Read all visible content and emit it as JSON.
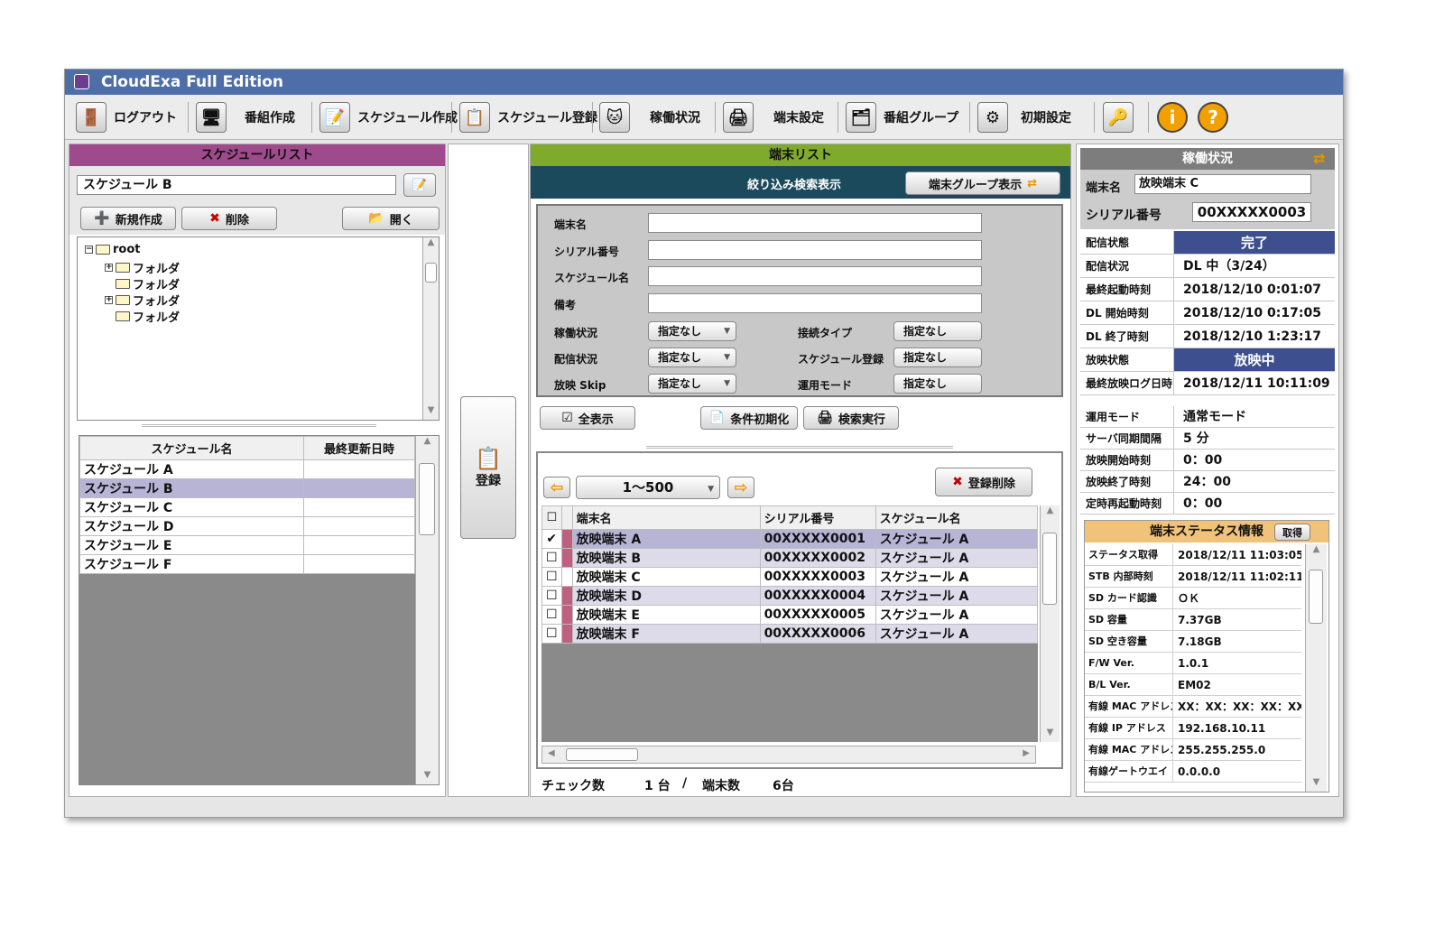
{
  "app": {
    "title": "CloudExa Full Edition"
  },
  "toolbar": {
    "logout": "ログアウト",
    "program": "番組作成",
    "schedule_create": "スケジュール作成",
    "schedule_register": "スケジュール登録",
    "operation_status": "稼働状況",
    "terminal_settings": "端末設定",
    "program_group": "番組グループ",
    "initial_settings": "初期設定"
  },
  "schedule_list": {
    "header": "スケジュールリスト",
    "current": "スケジュール B",
    "new_btn": "新規作成",
    "delete_btn": "削除",
    "open_btn": "開く",
    "tree": {
      "root": "root",
      "folders": [
        "フォルダ",
        "フォルダ",
        "フォルダ",
        "フォルダ"
      ]
    },
    "columns": [
      "スケジュール名",
      "最終更新日時"
    ],
    "rows": [
      "スケジュール A",
      "スケジュール B",
      "スケジュール C",
      "スケジュール D",
      "スケジュール E",
      "スケジュール F"
    ]
  },
  "register": {
    "label": "登録"
  },
  "terminal_list": {
    "header": "端末リスト",
    "filter_title": "絞り込み検索表示",
    "group_btn": "端末グループ表示",
    "filters": {
      "terminal_name": "端末名",
      "serial": "シリアル番号",
      "schedule": "スケジュール名",
      "note": "備考",
      "op_status": "稼働状況",
      "delivery_status": "配信状況",
      "play_skip": "放映 Skip",
      "conn_type": "接続タイプ",
      "sched_reg": "スケジュール登録",
      "op_mode": "運用モード",
      "unspecified": "指定なし"
    },
    "show_all": "全表示",
    "reset": "条件初期化",
    "search": "検索実行",
    "range": "1〜500",
    "unregister": "登録削除",
    "columns": [
      "端末名",
      "シリアル番号",
      "スケジュール名"
    ],
    "rows": [
      {
        "name": "放映端末 A",
        "serial": "00XXXXX0001",
        "schedule": "スケジュール A",
        "checked": "✔"
      },
      {
        "name": "放映端末 B",
        "serial": "00XXXXX0002",
        "schedule": "スケジュール A",
        "checked": ""
      },
      {
        "name": "放映端末 C",
        "serial": "00XXXXX0003",
        "schedule": "スケジュール A",
        "checked": ""
      },
      {
        "name": "放映端末 D",
        "serial": "00XXXXX0004",
        "schedule": "スケジュール A",
        "checked": ""
      },
      {
        "name": "放映端末 E",
        "serial": "00XXXXX0005",
        "schedule": "スケジュール A",
        "checked": ""
      },
      {
        "name": "放映端末 F",
        "serial": "00XXXXX0006",
        "schedule": "スケジュール A",
        "checked": ""
      }
    ],
    "footer": {
      "check_label": "チェック数",
      "check_count": "1 台",
      "slash": "/",
      "total_label": "端末数",
      "total_count": "6台"
    }
  },
  "status_panel": {
    "header": "稼働状況",
    "terminal_label": "端末名",
    "terminal_value": "放映端末 C",
    "serial_label": "シリアル番号",
    "serial_value": "00XXXXX0003",
    "rows1": [
      {
        "k": "配信状態",
        "v": "完了",
        "hl": true
      },
      {
        "k": "配信状況",
        "v": "DL 中（3/24）",
        "hl": false
      },
      {
        "k": "最終起動時刻",
        "v": "2018/12/10 0:01:07",
        "hl": false
      },
      {
        "k": "DL 開始時刻",
        "v": "2018/12/10 0:17:05",
        "hl": false
      },
      {
        "k": "DL 終了時刻",
        "v": "2018/12/10 1:23:17",
        "hl": false
      },
      {
        "k": "放映状態",
        "v": "放映中",
        "hl": true
      },
      {
        "k": "最終放映ログ日時",
        "v": "2018/12/11 10:11:09",
        "hl": false
      }
    ],
    "rows2": [
      {
        "k": "運用モード",
        "v": "通常モード"
      },
      {
        "k": "サーバ同期間隔",
        "v": "5 分"
      },
      {
        "k": "放映開始時刻",
        "v": "0：00"
      },
      {
        "k": "放映終了時刻",
        "v": "24：00"
      },
      {
        "k": "定時再起動時刻",
        "v": "0：00"
      }
    ],
    "info_header": "端末ステータス情報",
    "fetch_btn": "取得",
    "info_rows": [
      {
        "k": "ステータス取得",
        "v": "2018/12/11 11:03:05"
      },
      {
        "k": "STB 内部時刻",
        "v": "2018/12/11 11:02:11"
      },
      {
        "k": "SD カード認識",
        "v": "ＯＫ"
      },
      {
        "k": "SD 容量",
        "v": "7.37GB"
      },
      {
        "k": "SD 空き容量",
        "v": "7.18GB"
      },
      {
        "k": "F/W Ver.",
        "v": "1.0.1"
      },
      {
        "k": "B/L Ver.",
        "v": "EM02"
      },
      {
        "k": "有線 MAC アドレス",
        "v": "XX：XX：XX：XX：XX：XX"
      },
      {
        "k": "有線 IP アドレス",
        "v": "192.168.10.11"
      },
      {
        "k": "有線 MAC アドレス",
        "v": "255.255.255.0"
      },
      {
        "k": "有線ゲートウエイ",
        "v": "0.0.0.0"
      }
    ]
  },
  "colors": {
    "title_bar": "#4d6ea8",
    "schedule_header": "#9e4a8c",
    "terminal_header": "#7faa2c",
    "filter_bar": "#1a4a5c",
    "status_header": "#7d7d7d",
    "highlight": "#3e4f8f",
    "selected_row": "#b7b4d6"
  }
}
